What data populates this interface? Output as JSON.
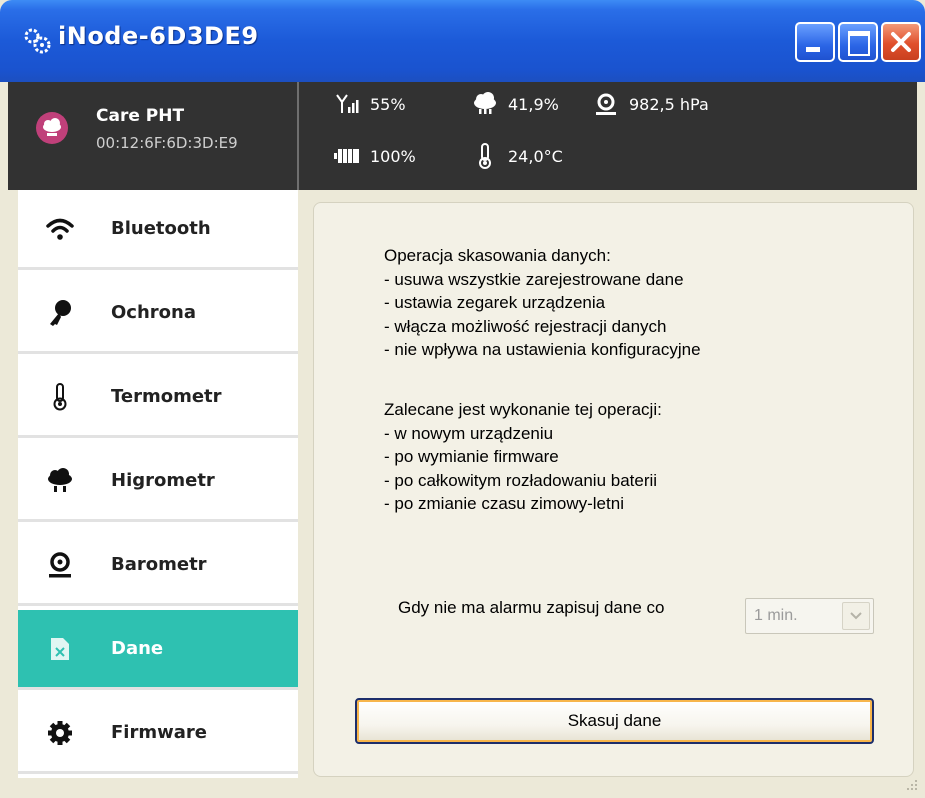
{
  "window": {
    "title": "iNode-6D3DE9"
  },
  "device": {
    "name": "Care PHT",
    "mac": "00:12:6F:6D:3D:E9",
    "signal": "55%",
    "humidity": "41,9%",
    "pressure": "982,5 hPa",
    "battery": "100%",
    "temperature": "24,0°C"
  },
  "sidebar": {
    "items": [
      {
        "label": "Bluetooth",
        "icon": "wifi-icon"
      },
      {
        "label": "Ochrona",
        "icon": "key-icon"
      },
      {
        "label": "Termometr",
        "icon": "thermometer-icon"
      },
      {
        "label": "Higrometr",
        "icon": "rain-cloud-icon"
      },
      {
        "label": "Barometr",
        "icon": "barometer-icon"
      },
      {
        "label": "Dane",
        "icon": "file-icon",
        "active": true
      },
      {
        "label": "Firmware",
        "icon": "gear-icon"
      }
    ]
  },
  "main": {
    "block1": [
      "Operacja skasowania danych:",
      "- usuwa wszystkie zarejestrowane dane",
      "- ustawia zegarek urządzenia",
      "- włącza możliwość rejestracji danych",
      "- nie wpływa na ustawienia konfiguracyjne"
    ],
    "block2": [
      "Zalecane jest wykonanie tej operacji:",
      "- w nowym urządzeniu",
      "- po wymianie firmware",
      "- po całkowitym rozładowaniu baterii",
      "- po zmianie czasu zimowy-letni"
    ],
    "interval_label": "Gdy nie ma alarmu zapisuj dane co",
    "interval_value": "1 min.",
    "wipe_button": "Skasuj dane"
  },
  "colors": {
    "active_item": "#2ec1b1",
    "header_bg": "#323232",
    "titlebar": "#1c5ad8"
  }
}
